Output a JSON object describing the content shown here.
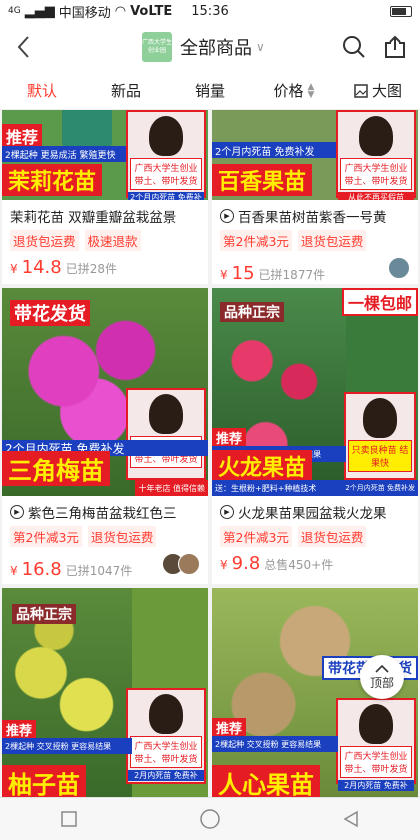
{
  "status_bar": {
    "carrier": "中国移动",
    "network": "VoLTE",
    "signal": "4G",
    "time": "15:36"
  },
  "header": {
    "shop_logo_text": "广西大学生创业园",
    "title": "全部商品",
    "title_chevron": "∨"
  },
  "tabs": [
    {
      "label": "默认",
      "active": true
    },
    {
      "label": "新品",
      "active": false
    },
    {
      "label": "销量",
      "active": false
    },
    {
      "label": "价格",
      "active": false
    },
    {
      "label": "大图",
      "active": false
    }
  ],
  "products": [
    {
      "title": "茉莉花苗 双瓣重瓣盆栽盆景",
      "has_video": false,
      "tags": [
        "退货包运费",
        "极速退款"
      ],
      "currency": "¥",
      "price": "14.8",
      "sold": "已拼28件",
      "image": {
        "badge": "推荐",
        "subtitle": "2棵起种 更易成活 繁殖更快",
        "name": "茉莉花苗",
        "footer": "2个月内死苗 免费补发",
        "sign": "广西大学生创业 带土、带叶发货",
        "bg": "#5a9a4a"
      }
    },
    {
      "title": "百香果苗树苗紫香一号黄",
      "has_video": true,
      "tags": [
        "第2件减3元",
        "退货包运费"
      ],
      "currency": "¥",
      "price": "15",
      "sold": "已拼1877件",
      "image": {
        "banner": "2个月内死苗 免费补发",
        "name": "百香果苗",
        "footer": "从此不再买假苗",
        "sign": "广西大学生创业 带土、带叶发货",
        "bg": "#7a9a5a"
      }
    },
    {
      "title": "紫色三角梅苗盆栽红色三",
      "has_video": true,
      "tags": [
        "第2件减3元",
        "退货包运费"
      ],
      "currency": "¥",
      "price": "16.8",
      "sold": "已拼1047件",
      "image": {
        "badge": "带花发货",
        "banner": "2个月内死苗 免费补发",
        "name": "三角梅苗",
        "footer": "十年老店 值得信赖",
        "sign": "广西大学生创业 带土、带叶发货",
        "bg": "#b03aa0"
      }
    },
    {
      "title": "火龙果苗果园盆栽火龙果",
      "has_video": true,
      "tags": [
        "第2件减3元",
        "退货包运费"
      ],
      "currency": "¥",
      "price": "9.8",
      "sold": "总售450+件",
      "image": {
        "badge": "品种正宗",
        "badge2": "一棵包邮",
        "recommend": "推荐",
        "subtitle": "2棵起种 交叉授粉 更容易结果",
        "name": "火龙果苗",
        "footer": "送：生根粉+肥料+种植技术",
        "footer2": "2个月内死苗 免费补发",
        "sign": "只卖良种苗 结果快",
        "bg": "#3a7a3a"
      }
    },
    {
      "title": "柚子苗",
      "image": {
        "badge": "品种正宗",
        "recommend": "推荐",
        "subtitle": "2棵起种 交叉授粉 更容易结果",
        "name": "柚子苗",
        "footer": "2月内死苗 免费补",
        "sign": "广西大学生创业 带土、带叶发货",
        "bg": "#6a9a3a"
      }
    },
    {
      "title": "人心果苗",
      "image": {
        "badge": "带花带果发货",
        "recommend": "推荐",
        "subtitle": "2棵起种 交叉授粉 更容易结果",
        "name": "人心果苗",
        "footer": "2月内死苗 免费补",
        "sign": "广西大学生创业 带土、带叶发货",
        "bg": "#8aa84a"
      }
    }
  ],
  "back_to_top": {
    "label": "顶部"
  },
  "colors": {
    "accent": "#ff3b30",
    "badge_red": "#e51c23",
    "name_yellow": "#ffee00",
    "banner_blue": "#1a3fbf"
  }
}
